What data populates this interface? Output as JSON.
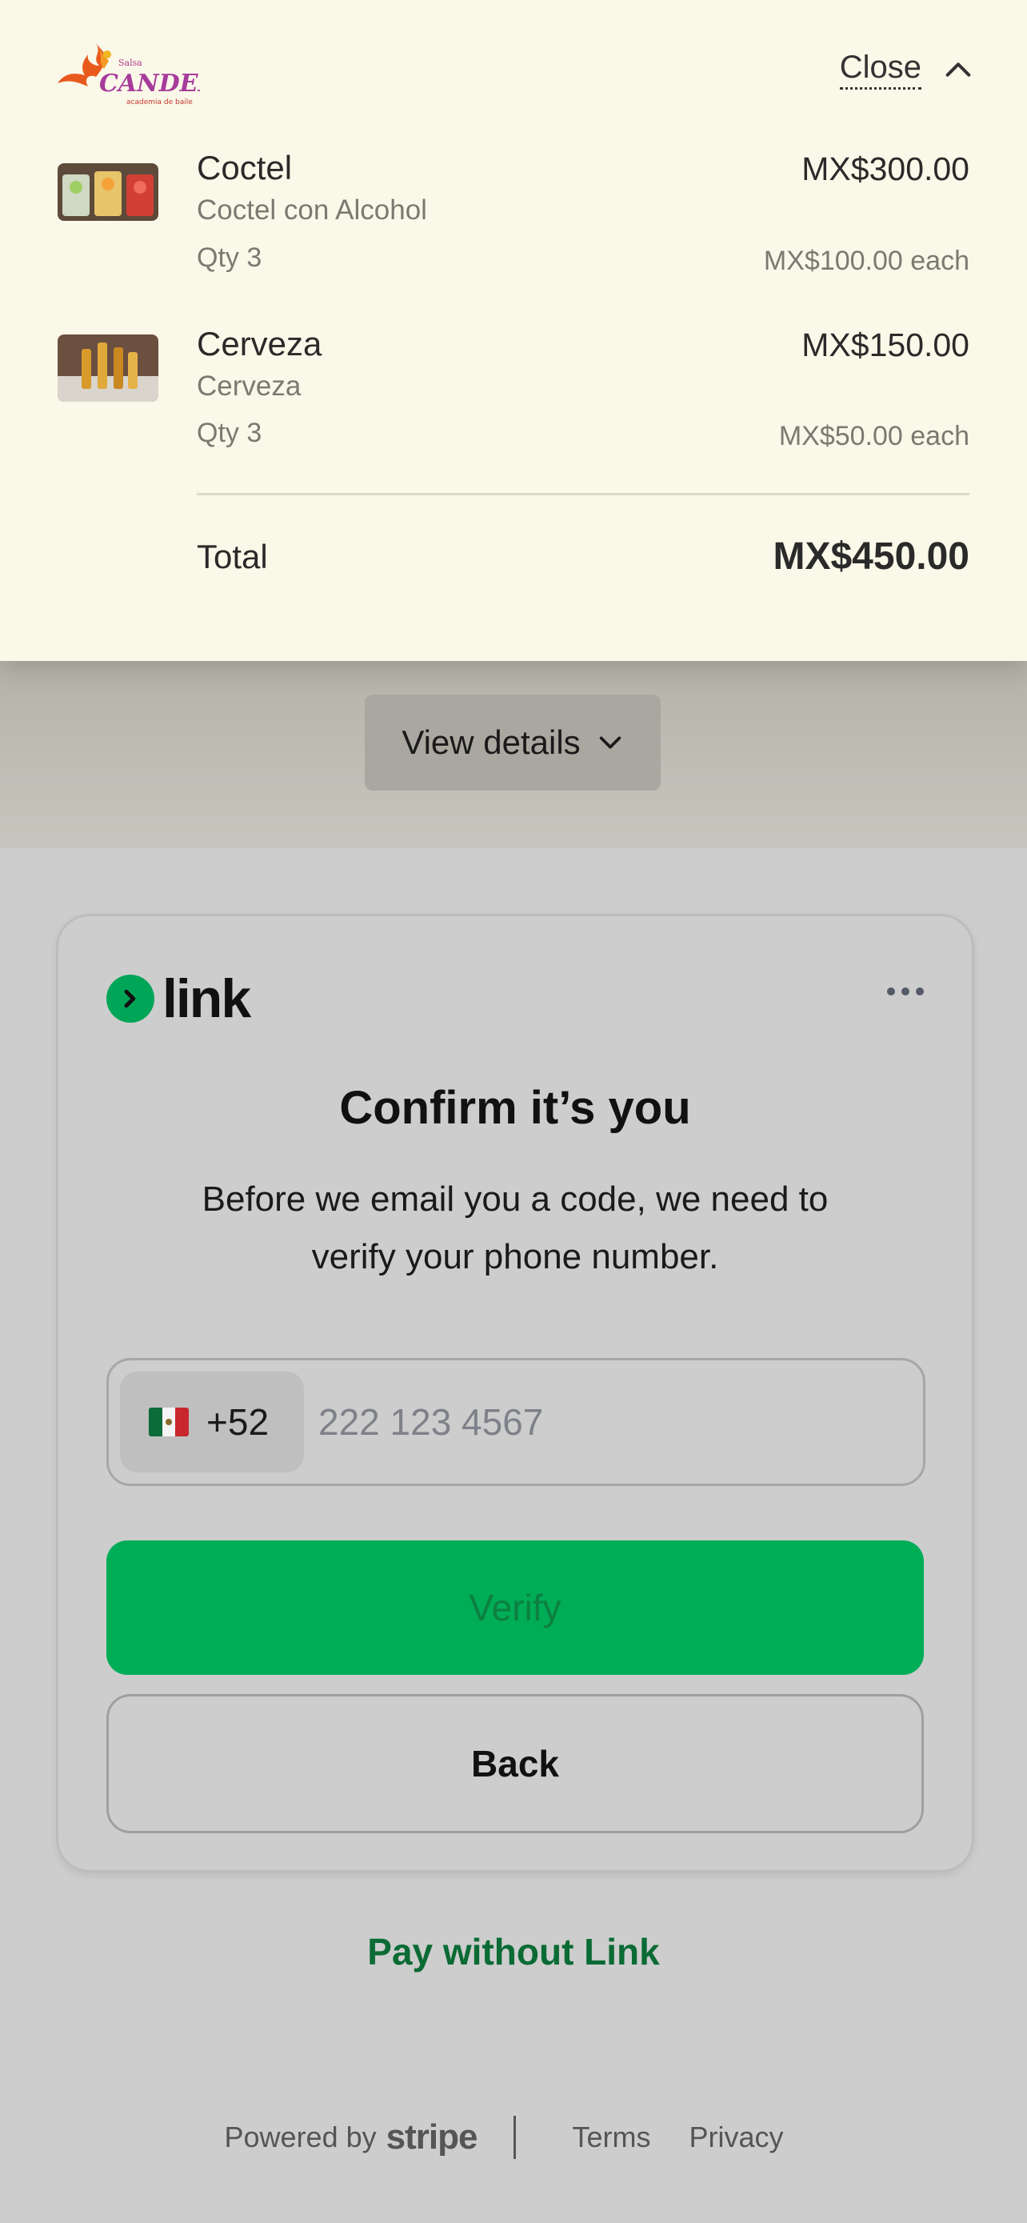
{
  "summary": {
    "logo": {
      "small_text": "Salsa",
      "main_text": "CANDELA",
      "tagline": "academia de baile"
    },
    "close_label": "Close",
    "items": [
      {
        "name": "Coctel",
        "description": "Coctel con Alcohol",
        "qty": "Qty 3",
        "price": "MX$300.00",
        "each": "MX$100.00 each"
      },
      {
        "name": "Cerveza",
        "description": "Cerveza",
        "qty": "Qty 3",
        "price": "MX$150.00",
        "each": "MX$50.00 each"
      }
    ],
    "total_label": "Total",
    "total_value": "MX$450.00"
  },
  "view_details_label": "View details",
  "link_card": {
    "brand": "link",
    "title": "Confirm it’s you",
    "subtitle": "Before we email you a code, we need to verify your phone number.",
    "country_code": "+52",
    "phone_placeholder": "222 123 4567",
    "verify_label": "Verify",
    "back_label": "Back"
  },
  "pay_without_link": "Pay without Link",
  "footer": {
    "powered_by": "Powered by",
    "brand": "stripe",
    "terms": "Terms",
    "privacy": "Privacy"
  },
  "colors": {
    "accent_green": "#00ad57",
    "link_green_text": "#0a6b34",
    "summary_bg": "#faf8e8"
  }
}
